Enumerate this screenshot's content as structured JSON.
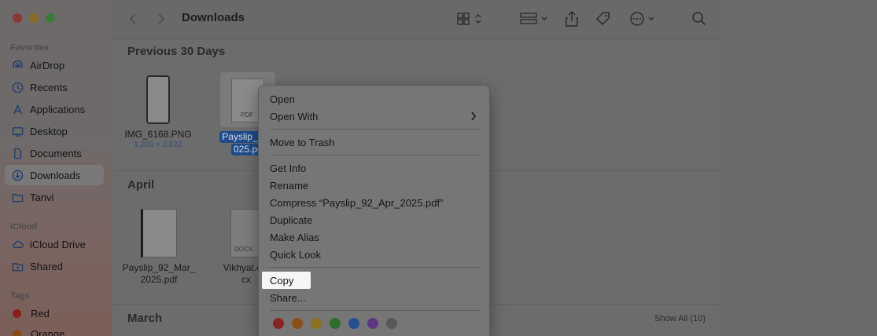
{
  "window": {
    "title": "Downloads"
  },
  "sidebar": {
    "favorites_heading": "Favorites",
    "favorites": [
      {
        "label": "AirDrop",
        "icon": "airdrop-icon"
      },
      {
        "label": "Recents",
        "icon": "clock-icon"
      },
      {
        "label": "Applications",
        "icon": "applications-icon"
      },
      {
        "label": "Desktop",
        "icon": "desktop-icon"
      },
      {
        "label": "Documents",
        "icon": "document-icon"
      },
      {
        "label": "Downloads",
        "icon": "download-icon",
        "active": true
      },
      {
        "label": "Tanvi",
        "icon": "folder-icon"
      }
    ],
    "icloud_heading": "iCloud",
    "icloud": [
      {
        "label": "iCloud Drive",
        "icon": "cloud-icon"
      },
      {
        "label": "Shared",
        "icon": "shared-folder-icon"
      }
    ],
    "tags_heading": "Tags",
    "tags": [
      {
        "label": "Red",
        "color": "#8a1e1a"
      },
      {
        "label": "Orange",
        "color": "#8a4a14"
      }
    ]
  },
  "sections": {
    "previous30": {
      "title": "Previous 30 Days",
      "files": [
        {
          "name": "IMG_6168.PNG",
          "meta": "1,206 × 2,622"
        },
        {
          "name_line1": "Payslip_92_",
          "name_line2": "025.pc",
          "badge": "PDF",
          "selected": true
        }
      ]
    },
    "april": {
      "title": "April",
      "files": [
        {
          "name_line1": "Payslip_92_Mar_",
          "name_line2": "2025.pdf"
        },
        {
          "name_line1": "Vikhyat.edi",
          "name_line2": "cx",
          "badge": "DOCX"
        }
      ]
    },
    "march": {
      "title": "March",
      "show_all": "Show All (10)"
    }
  },
  "context_menu": {
    "open": "Open",
    "open_with": "Open With",
    "move_to_trash": "Move to Trash",
    "get_info": "Get Info",
    "rename": "Rename",
    "compress": "Compress “Payslip_92_Apr_2025.pdf”",
    "duplicate": "Duplicate",
    "make_alias": "Make Alias",
    "quick_look": "Quick Look",
    "copy": "Copy",
    "share": "Share...",
    "tag_colors": [
      "#8a2622",
      "#8a4e1a",
      "#8a7220",
      "#2f6e2c",
      "#24508f",
      "#5e3782",
      "#585858"
    ]
  }
}
